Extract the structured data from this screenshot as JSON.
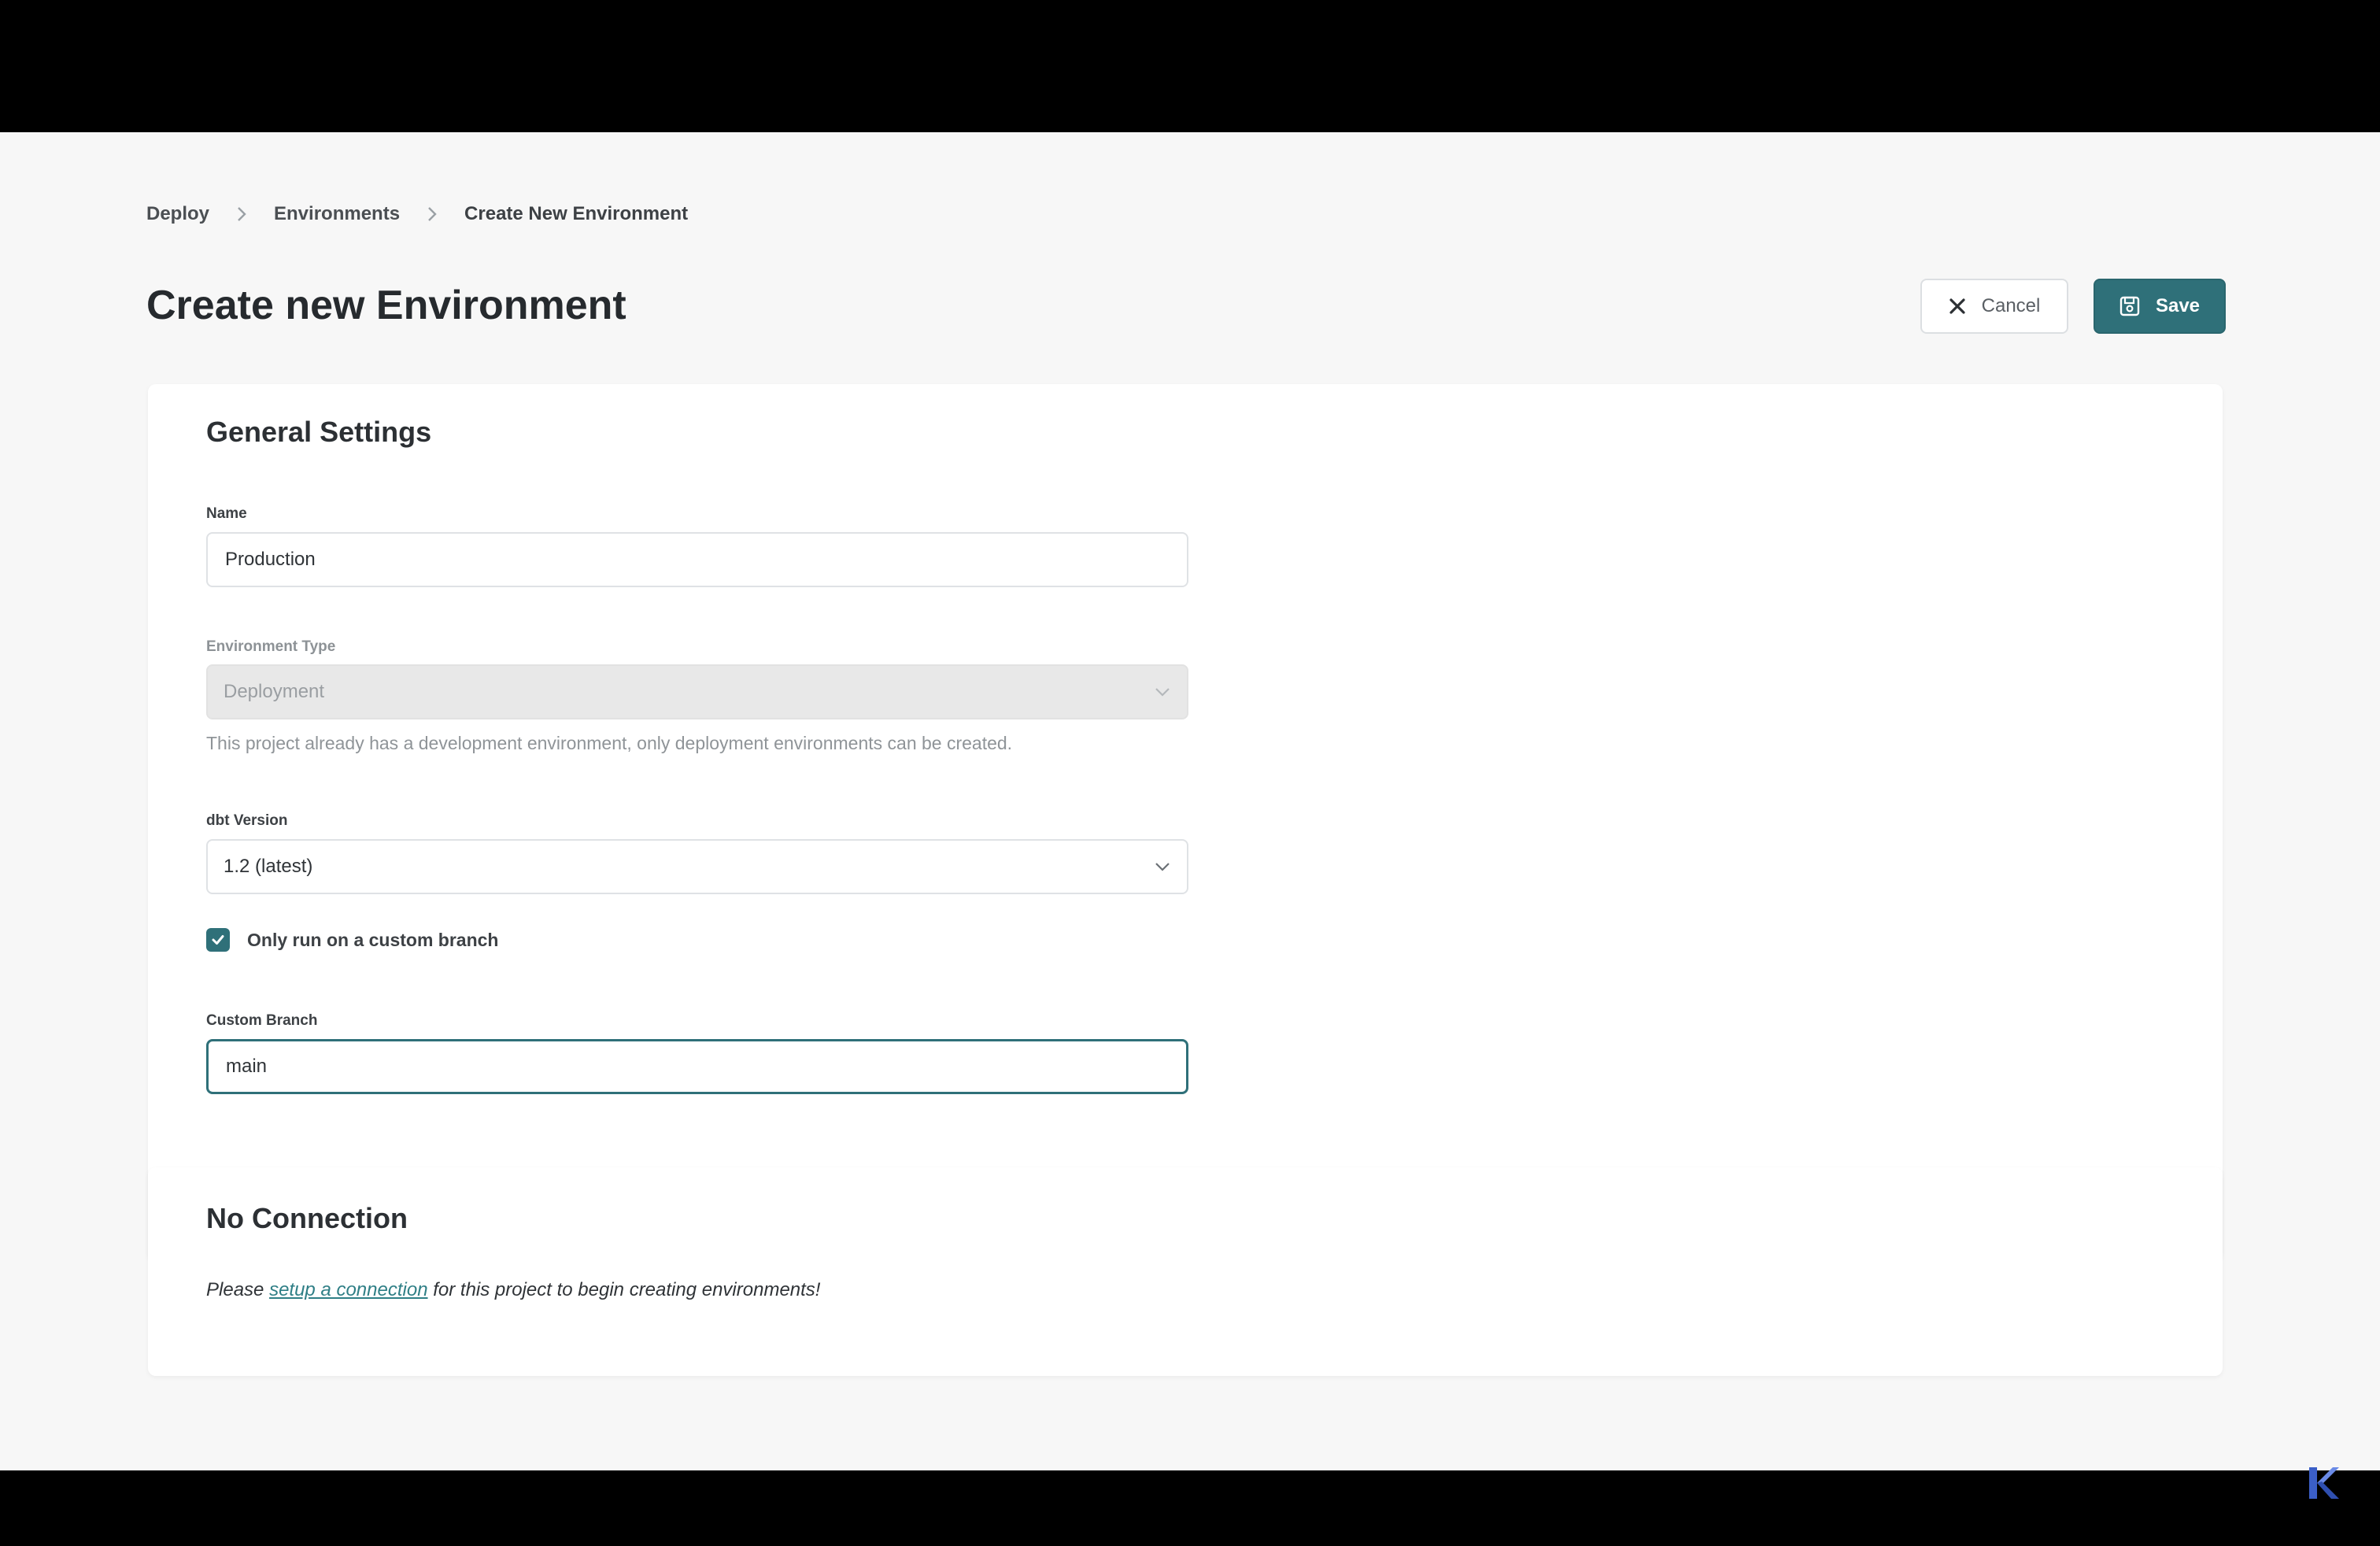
{
  "breadcrumb": {
    "items": [
      "Deploy",
      "Environments",
      "Create New Environment"
    ]
  },
  "page": {
    "title": "Create new Environment"
  },
  "actions": {
    "cancel_label": "Cancel",
    "save_label": "Save"
  },
  "general_settings": {
    "title": "General Settings",
    "name": {
      "label": "Name",
      "value": "Production"
    },
    "environment_type": {
      "label": "Environment Type",
      "value": "Deployment",
      "disabled": true,
      "help": "This project already has a development environment, only deployment environments can be created."
    },
    "dbt_version": {
      "label": "dbt Version",
      "value": "1.2 (latest)"
    },
    "custom_branch_checkbox": {
      "label": "Only run on a custom branch",
      "checked": true
    },
    "custom_branch": {
      "label": "Custom Branch",
      "value": "main"
    }
  },
  "connection": {
    "title": "No Connection",
    "message_prefix": "Please",
    "link_text": "setup a connection",
    "message_suffix": "for this project to begin creating environments!"
  },
  "colors": {
    "accent": "#2f7079",
    "page_background": "#f7f7f7",
    "card_background": "#ffffff",
    "letterbox": "#000000",
    "corner_logo": "#4a6fd8"
  },
  "icons": {
    "breadcrumb_separator": "chevron-right-icon",
    "cancel": "close-icon",
    "save": "floppy-disk-icon",
    "select": "chevron-down-icon",
    "checkbox": "checkmark-icon",
    "corner_logo": "k-logo-icon"
  }
}
